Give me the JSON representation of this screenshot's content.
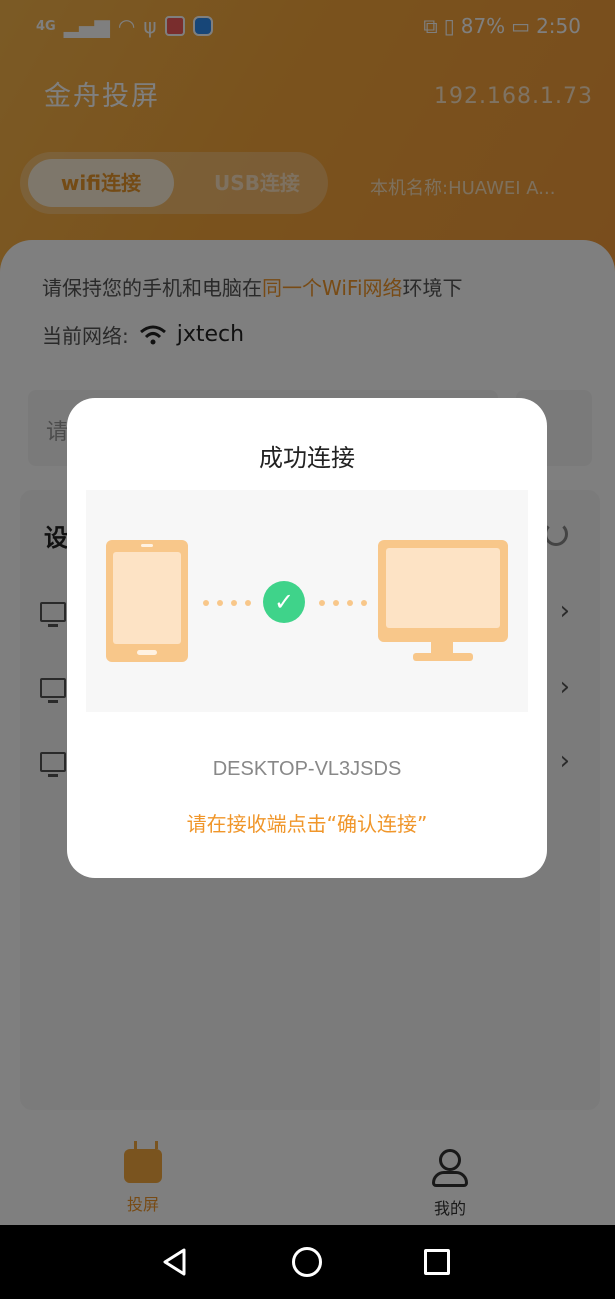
{
  "status_bar": {
    "signal": "4G",
    "battery": "87%",
    "time": "2:50"
  },
  "header": {
    "app_title": "金舟投屏",
    "ip": "192.168.1.73",
    "tabs": [
      {
        "label": "wifi连接",
        "active": true
      },
      {
        "label": "USB连接",
        "active": false
      }
    ],
    "device_name": "本机名称:HUAWEI  A..."
  },
  "main": {
    "hint_prefix": "请保持您的手机和电脑在",
    "hint_highlight": "同一个WiFi网络",
    "hint_suffix": "环境下",
    "network_label": "当前网络:",
    "network_ssid": "jxtech",
    "input_placeholder": "请",
    "panel_title": "设"
  },
  "bottom_nav": {
    "items": [
      {
        "label": "投屏",
        "icon": "tv-icon",
        "active": true
      },
      {
        "label": "我的",
        "icon": "user-icon",
        "active": false
      }
    ]
  },
  "dialog": {
    "title": "成功连接",
    "device": "DESKTOP-VL3JSDS",
    "hint": "请在接收端点击“确认连接”"
  },
  "colors": {
    "accent": "#f0962a",
    "success": "#3fd38a",
    "header_gradient_start": "#f7b54b",
    "header_gradient_end": "#f29a3a"
  }
}
